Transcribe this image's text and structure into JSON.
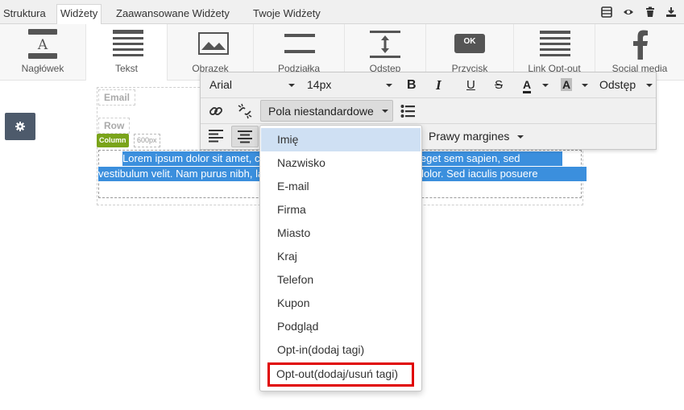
{
  "tabs": [
    {
      "label": "Struktura",
      "active": false
    },
    {
      "label": "Widżety",
      "active": true
    },
    {
      "label": "Zaawansowane Widżety",
      "active": false
    },
    {
      "label": "Twoje Widżety",
      "active": false
    }
  ],
  "top_icons": [
    "layout-icon",
    "eye-icon",
    "trash-icon",
    "download-icon"
  ],
  "widgets": [
    {
      "label": "Nagłówek",
      "icon": "heading-icon",
      "selected": false
    },
    {
      "label": "Tekst",
      "icon": "text-icon",
      "selected": true
    },
    {
      "label": "Obrazek",
      "icon": "image-icon",
      "selected": false
    },
    {
      "label": "Podziałka",
      "icon": "divider-icon",
      "selected": false
    },
    {
      "label": "Odstęp",
      "icon": "spacer-icon",
      "selected": false
    },
    {
      "label": "Przycisk",
      "icon": "button-icon",
      "button_text": "OK",
      "selected": false
    },
    {
      "label": "Link Opt-out",
      "icon": "link-optout-icon",
      "selected": false
    },
    {
      "label": "Social media",
      "icon": "facebook-icon",
      "selected": false
    }
  ],
  "canvas": {
    "email_ghost": "Email",
    "row_ghost": "Row",
    "column_badge": "Column",
    "column_size": "600px",
    "text_line1": "Lorem ipsum dolor sit amet, consectetur adipiscing elit. Aliquam eget sem sapien, sed",
    "text_line2": "vestibulum velit. Nam purus nibh, lacinia non faucibus et, pharetra in dolor. Sed iaculis posuere"
  },
  "toolbar": {
    "font_family": "Arial",
    "font_size": "14px",
    "bold": "B",
    "italic": "I",
    "underline": "U",
    "strike": "S",
    "text_color": "A",
    "bg_color": "A",
    "spacing": "Odstęp",
    "custom_fields": "Pola niestandardowe",
    "margin": "Prawy margines"
  },
  "dropdown": {
    "items": [
      {
        "label": "Imię",
        "highlighted": true
      },
      {
        "label": "Nazwisko"
      },
      {
        "label": "E-mail"
      },
      {
        "label": "Firma"
      },
      {
        "label": "Miasto"
      },
      {
        "label": "Kraj"
      },
      {
        "label": "Telefon"
      },
      {
        "label": "Kupon"
      },
      {
        "label": "Podgląd"
      },
      {
        "label": "Opt-in(dodaj tagi)"
      },
      {
        "label": "Opt-out(dodaj/usuń tagi)",
        "boxed": true
      }
    ]
  },
  "colors": {
    "selection": "#3b8fdd",
    "highlight": "#cfe0f3",
    "callout": "#e00000",
    "badge": "#7aa41a",
    "gear_bg": "#4d5a6b"
  }
}
